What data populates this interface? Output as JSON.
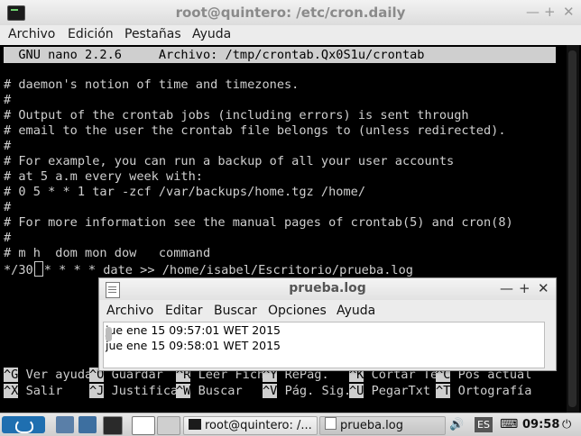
{
  "window": {
    "title": "root@quintero: /etc/cron.daily",
    "minimize": "—",
    "maximize": "+",
    "close": "✕",
    "menu": [
      "Archivo",
      "Edición",
      "Pestañas",
      "Ayuda"
    ]
  },
  "nano": {
    "header": "  GNU nano 2.2.6     Archivo: /tmp/crontab.Qx0S1u/crontab",
    "lines": [
      "# daemon's notion of time and timezones.",
      "#",
      "# Output of the crontab jobs (including errors) is sent through",
      "# email to the user the crontab file belongs to (unless redirected).",
      "#",
      "# For example, you can run a backup of all your user accounts",
      "# at 5 a.m every week with:",
      "# 0 5 * * 1 tar -zcf /var/backups/home.tgz /home/",
      "#",
      "# For more information see the manual pages of crontab(5) and cron(8)",
      "#",
      "# m h  dom mon dow   command"
    ],
    "cursor_line_before": "*/30",
    "cursor_line_after": "* * * * date >> /home/isabel/Escritorio/prueba.log",
    "shortcuts_row1": [
      {
        "key": "^G",
        "label": "Ver ayuda"
      },
      {
        "key": "^O",
        "label": "Guardar"
      },
      {
        "key": "^R",
        "label": "Leer Fich"
      },
      {
        "key": "^Y",
        "label": "RePág."
      },
      {
        "key": "^K",
        "label": "Cortar Te"
      },
      {
        "key": "^C",
        "label": "Pos actual"
      }
    ],
    "shortcuts_row2": [
      {
        "key": "^X",
        "label": "Salir"
      },
      {
        "key": "^J",
        "label": "Justifica"
      },
      {
        "key": "^W",
        "label": "Buscar"
      },
      {
        "key": "^V",
        "label": "Pág. Sig."
      },
      {
        "key": "^U",
        "label": "PegarTxt"
      },
      {
        "key": "^T",
        "label": "Ortografía"
      }
    ]
  },
  "leafpad": {
    "title": "prueba.log",
    "minimize": "—",
    "maximize": "+",
    "close": "✕",
    "menu": [
      "Archivo",
      "Editar",
      "Buscar",
      "Opciones",
      "Ayuda"
    ],
    "lines": [
      "jue ene 15 09:57:01 WET 2015",
      "jue ene 15 09:58:01 WET 2015"
    ]
  },
  "taskbar": {
    "tasks": [
      "root@quintero: /...",
      "prueba.log"
    ],
    "keyboard_layout": "ES",
    "clock": "09:58",
    "power": "⏻",
    "volume": "🔊"
  },
  "colors": {
    "terminal_bg": "#000000",
    "terminal_fg": "#cfcfcf",
    "start_button": "#1f6fb0"
  }
}
